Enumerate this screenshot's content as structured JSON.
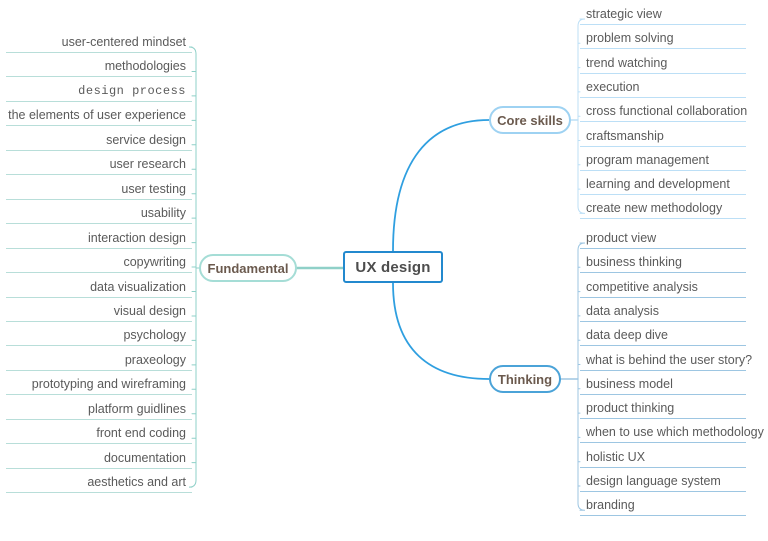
{
  "diagram": {
    "kind": "mind-map",
    "title": "UX design",
    "background_color": "#ffffff",
    "center": {
      "label": "UX design",
      "border_color": "#2389ce",
      "text_color": "#4d4d4d"
    },
    "branches": [
      {
        "id": "fundamental",
        "label": "Fundamental",
        "side": "left",
        "border_color": "#a5ddd6",
        "line_color": "#8fd0c8",
        "text_color": "#6b5a4e",
        "topics": [
          {
            "label": "user-centered mindset",
            "style": "normal"
          },
          {
            "label": "methodologies",
            "style": "normal"
          },
          {
            "label": "design process",
            "style": "mono"
          },
          {
            "label": "the elements of user experience",
            "style": "normal"
          },
          {
            "label": "service design",
            "style": "normal"
          },
          {
            "label": "user research",
            "style": "normal"
          },
          {
            "label": "user testing",
            "style": "normal"
          },
          {
            "label": "usability",
            "style": "normal"
          },
          {
            "label": "interaction design",
            "style": "normal"
          },
          {
            "label": "copywriting",
            "style": "normal"
          },
          {
            "label": "data visualization",
            "style": "normal"
          },
          {
            "label": "visual design",
            "style": "normal"
          },
          {
            "label": "psychology",
            "style": "normal"
          },
          {
            "label": "praxeology",
            "style": "normal"
          },
          {
            "label": "prototyping and wireframing",
            "style": "normal"
          },
          {
            "label": "platform guidlines",
            "style": "normal"
          },
          {
            "label": "front end coding",
            "style": "normal"
          },
          {
            "label": "documentation",
            "style": "normal"
          },
          {
            "label": "aesthetics and art",
            "style": "normal"
          }
        ]
      },
      {
        "id": "core-skills",
        "label": "Core skills",
        "side": "right",
        "border_color": "#9ed2f2",
        "line_color": "#bcdff6",
        "text_color": "#6b5a4e",
        "topics": [
          {
            "label": "strategic view",
            "style": "normal"
          },
          {
            "label": "problem solving",
            "style": "normal"
          },
          {
            "label": "trend watching",
            "style": "normal"
          },
          {
            "label": "execution",
            "style": "normal"
          },
          {
            "label": "cross functional collaboration",
            "style": "normal"
          },
          {
            "label": "craftsmanship",
            "style": "normal"
          },
          {
            "label": "program management",
            "style": "normal"
          },
          {
            "label": "learning and development",
            "style": "normal"
          },
          {
            "label": "create new methodology",
            "style": "normal"
          }
        ]
      },
      {
        "id": "thinking",
        "label": "Thinking",
        "side": "right",
        "border_color": "#4ba3d8",
        "line_color": "#9dc6e2",
        "text_color": "#6b5a4e",
        "topics": [
          {
            "label": "product view",
            "style": "normal"
          },
          {
            "label": "business thinking",
            "style": "normal"
          },
          {
            "label": "competitive analysis",
            "style": "normal"
          },
          {
            "label": "data analysis",
            "style": "normal"
          },
          {
            "label": "data deep dive",
            "style": "normal"
          },
          {
            "label": "what is behind the user story?",
            "style": "normal"
          },
          {
            "label": "business model",
            "style": "normal"
          },
          {
            "label": "product thinking",
            "style": "normal"
          },
          {
            "label": "when to use which methodology",
            "style": "normal"
          },
          {
            "label": "holistic UX",
            "style": "normal"
          },
          {
            "label": "design language system",
            "style": "normal"
          },
          {
            "label": "branding",
            "style": "normal"
          }
        ]
      }
    ]
  }
}
